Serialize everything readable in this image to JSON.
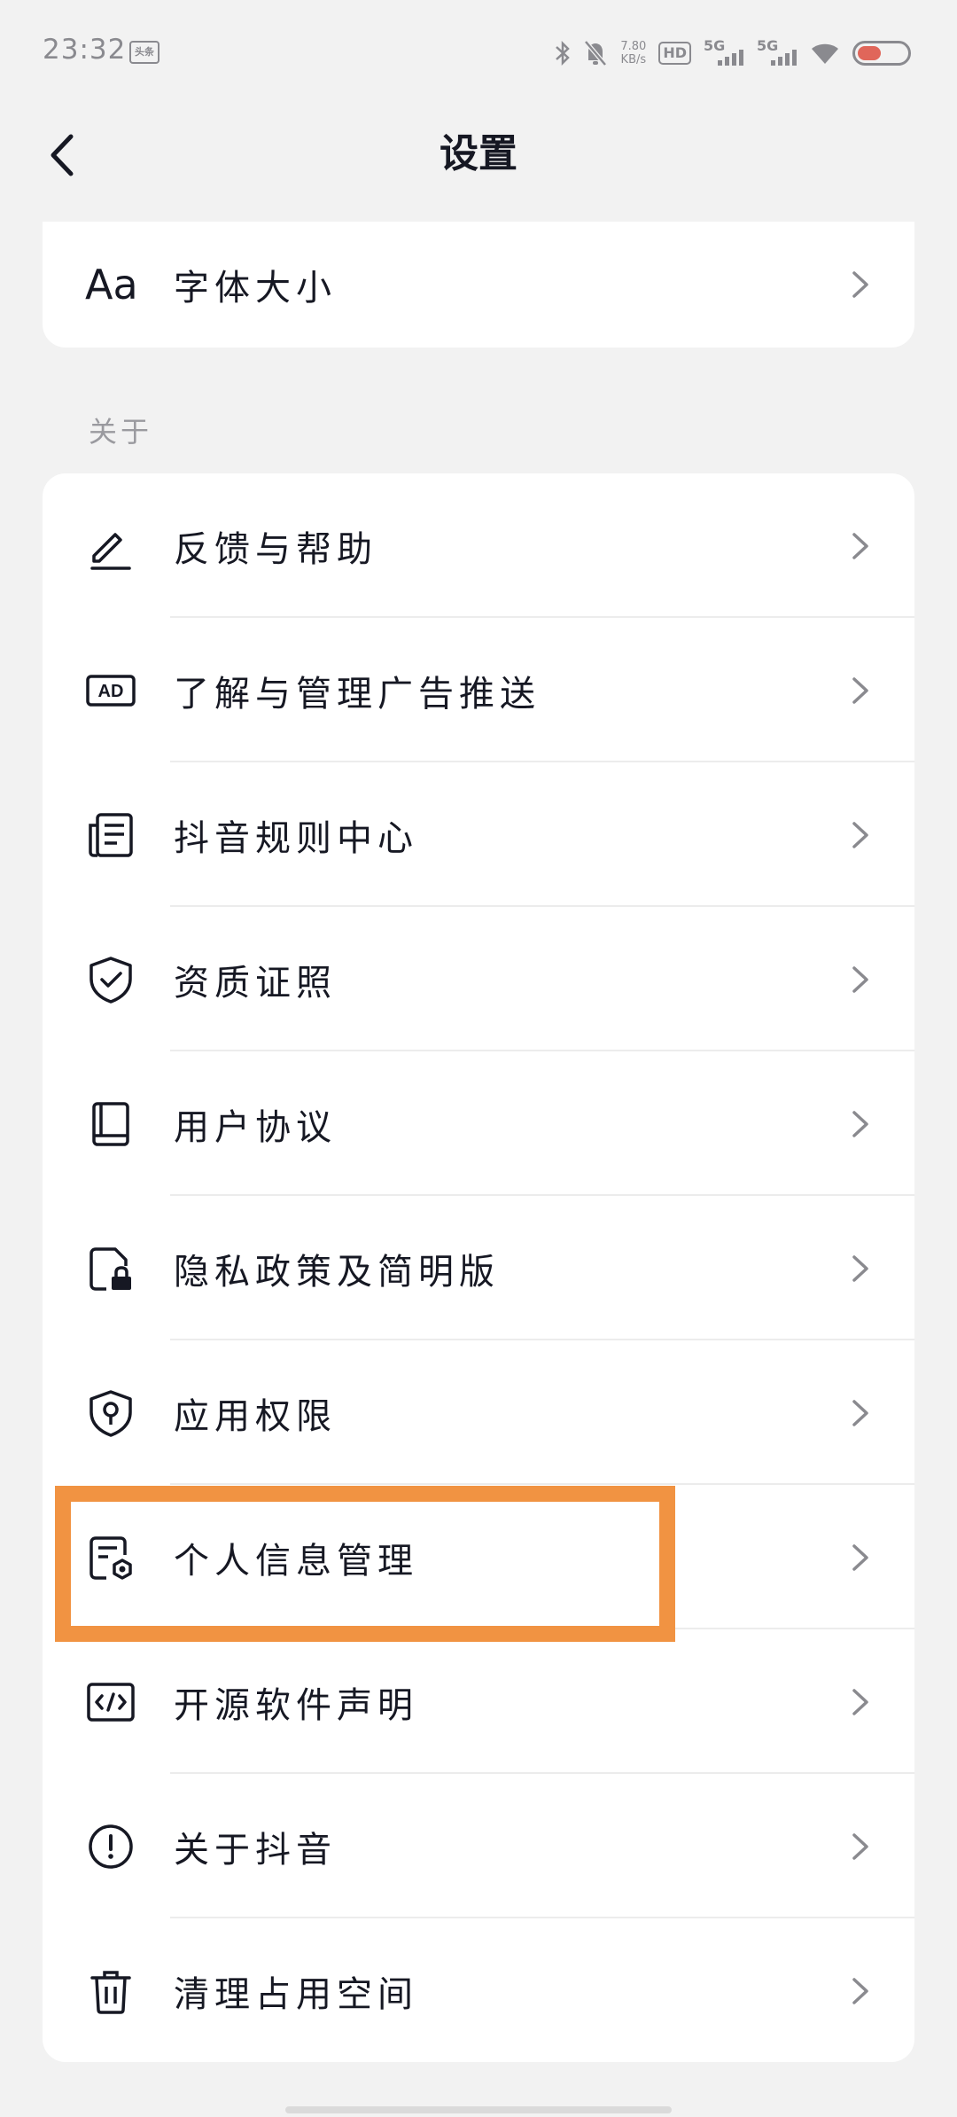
{
  "status_bar": {
    "time": "23:32",
    "app_badge": "头条",
    "net_speed_value": "7.80",
    "net_speed_unit": "KB/s",
    "hd_label": "HD",
    "network1": "5G",
    "network2": "5G"
  },
  "header": {
    "title": "设置",
    "back_icon": "chevron-left-icon"
  },
  "top_card": {
    "items": [
      {
        "icon_text": "Aa",
        "icon": "font-size-icon",
        "label": "字体大小"
      }
    ]
  },
  "about_section": {
    "label": "关于",
    "items": [
      {
        "icon": "edit-pen-icon",
        "label": "反馈与帮助"
      },
      {
        "icon": "ad-icon",
        "label": "了解与管理广告推送"
      },
      {
        "icon": "document-list-icon",
        "label": "抖音规则中心"
      },
      {
        "icon": "shield-check-icon",
        "label": "资质证照"
      },
      {
        "icon": "book-icon",
        "label": "用户协议"
      },
      {
        "icon": "file-lock-icon",
        "label": "隐私政策及简明版"
      },
      {
        "icon": "shield-key-icon",
        "label": "应用权限"
      },
      {
        "icon": "file-settings-icon",
        "label": "个人信息管理"
      },
      {
        "icon": "code-icon",
        "label": "开源软件声明"
      },
      {
        "icon": "info-circle-icon",
        "label": "关于抖音"
      },
      {
        "icon": "trash-icon",
        "label": "清理占用空间"
      }
    ]
  },
  "colors": {
    "highlight": "#f19342",
    "background": "#f2f2f2",
    "card": "#ffffff",
    "text": "#161823",
    "chevron": "#8a8a8f"
  }
}
